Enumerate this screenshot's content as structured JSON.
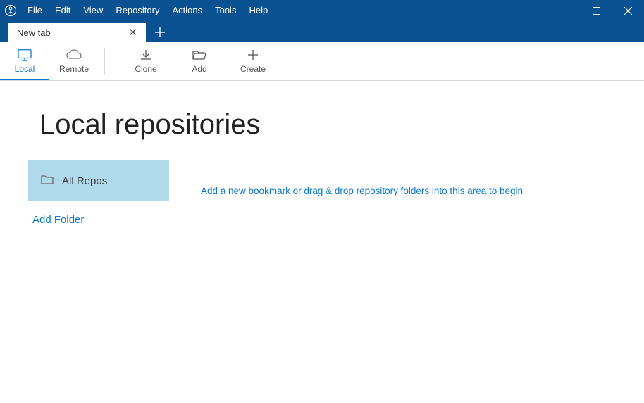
{
  "menu": {
    "items": [
      "File",
      "Edit",
      "View",
      "Repository",
      "Actions",
      "Tools",
      "Help"
    ]
  },
  "tabs": {
    "active": "New tab"
  },
  "toolbar": {
    "local": "Local",
    "remote": "Remote",
    "clone": "Clone",
    "add": "Add",
    "create": "Create"
  },
  "page": {
    "title": "Local repositories",
    "all_repos": "All Repos",
    "add_folder": "Add Folder",
    "hint": "Add a new bookmark or drag & drop repository folders into this area to begin"
  }
}
